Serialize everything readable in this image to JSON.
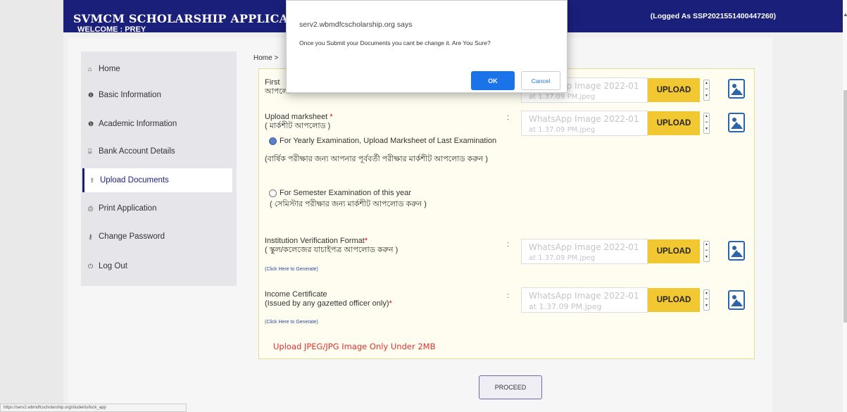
{
  "header": {
    "brand": "SVMCM SCHOLARSHIP APPLICATION",
    "welcome": "WELCOME : PREY",
    "logged_as": "(Logged As SSP2021551400447260)"
  },
  "sidebar": {
    "items": [
      {
        "label": "Home",
        "icon": "home-icon",
        "glyph": "⌂"
      },
      {
        "label": "Basic Information",
        "icon": "info-icon",
        "glyph": "❶"
      },
      {
        "label": "Academic Information",
        "icon": "info-icon",
        "glyph": "❶"
      },
      {
        "label": "Bank Account Details",
        "icon": "bank-icon",
        "glyph": "⌸"
      },
      {
        "label": "Upload Documents",
        "icon": "upload-icon",
        "glyph": "⇪"
      },
      {
        "label": "Print Application",
        "icon": "print-icon",
        "glyph": "⎙"
      },
      {
        "label": "Change Password",
        "icon": "key-icon",
        "glyph": "⚷"
      },
      {
        "label": "Log Out",
        "icon": "power-icon",
        "glyph": "⏻"
      }
    ],
    "active_index": 4
  },
  "breadcrumb": "Home >",
  "form": {
    "first_label_1": "First",
    "first_label_2": "আপলো",
    "first_file_1": "WhatsApp Image 2022-01",
    "first_file_2": "at 1.37.09 PM.jpeg",
    "marksheet_label": "Upload marksheet",
    "marksheet_label_bn": "( মার্কশীট আপলোড )",
    "marksheet_file_1": "WhatsApp Image 2022-01",
    "marksheet_file_2": "at 1.37.09 PM.jpeg",
    "radio_yearly": "For Yearly Examination, Upload Marksheet of Last Examination",
    "radio_yearly_bn": "(বার্ষিক পরীক্ষার জন্য আপনার পূর্ববর্তী পরীক্ষার মার্কশীট আপলোড করুন )",
    "radio_semester": "For Semester Examination of this year",
    "radio_semester_bn": "( সেমিস্টার পরীক্ষার জন্য মার্কশীট আপলোড করুন )",
    "institution_label": "Institution Verification Format",
    "institution_label_bn": "( স্কুল/কলেজের যাচাইপত্র আপলোড করুন )",
    "institution_link": "(Click Here to Generate)",
    "institution_file_1": "WhatsApp Image 2022-01",
    "institution_file_2": "at 1.37.09 PM.jpeg",
    "income_label": "Income Certificate",
    "income_label_2": "(Issued by any gazetted officer only)",
    "income_link": "(Click Here to Generate)",
    "income_file_1": "WhatsApp Image 2022-01",
    "income_file_2": "at 1.37.09 PM.jpeg",
    "upload_label": "UPLOAD",
    "colon": ":",
    "required_mark": "*",
    "note": "Upload JPEG/JPG Image Only Under 2MB"
  },
  "proceed_label": "PROCEED",
  "dialog": {
    "origin": "serv2.wbmdfcscholarship.org says",
    "message": "Once you Submit your Documents you cant be change it. Are You Sure?",
    "ok_label": "OK",
    "cancel_label": "Cancel"
  },
  "status_url": "https://serv2.wbmdfcscholarship.org/students/lock_app",
  "colors": {
    "header": "#1a1f7a",
    "upload_button": "#f2c832",
    "ok_button": "#1a73e8",
    "note_red": "#d33"
  }
}
